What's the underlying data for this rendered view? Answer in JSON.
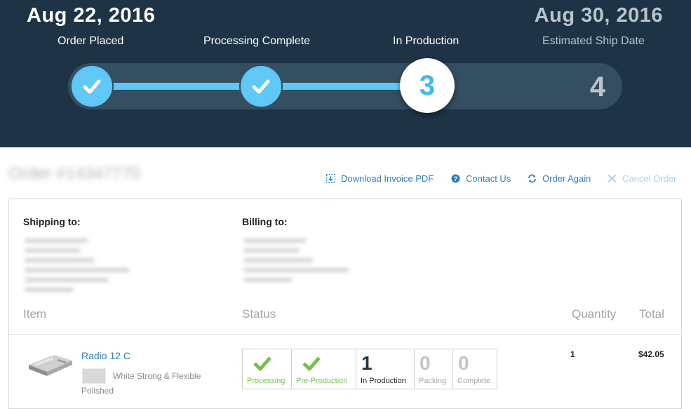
{
  "tracker": {
    "start_date": "Aug 22, 2016",
    "end_date": "Aug 30, 2016",
    "steps": [
      {
        "label": "Order Placed",
        "state": "done"
      },
      {
        "label": "Processing Complete",
        "state": "done"
      },
      {
        "label": "In Production",
        "number": "3",
        "state": "current"
      },
      {
        "label": "Estimated Ship Date",
        "number": "4",
        "state": "future"
      }
    ]
  },
  "order": {
    "title": "Order #14347770"
  },
  "actions": {
    "download_invoice": "Download Invoice PDF",
    "contact_us": "Contact Us",
    "order_again": "Order Again",
    "cancel_order": "Cancel Order"
  },
  "addresses": {
    "shipping_label": "Shipping to:",
    "billing_label": "Billing to:"
  },
  "table": {
    "headers": {
      "item": "Item",
      "status": "Status",
      "quantity": "Quantity",
      "total": "Total"
    },
    "rows": [
      {
        "name": "Radio 12 C",
        "material": "White Strong & Flexible",
        "finish": "Polished",
        "status": [
          {
            "caption": "Processing",
            "state": "done"
          },
          {
            "caption": "Pre-Production",
            "state": "done"
          },
          {
            "caption": "In Production",
            "count": "1",
            "state": "active"
          },
          {
            "caption": "Packing",
            "count": "0",
            "state": "inactive"
          },
          {
            "caption": "Complete",
            "count": "0",
            "state": "inactive"
          }
        ],
        "quantity": "1",
        "total": "$42.05"
      }
    ]
  },
  "colors": {
    "header_bg": "#1e3446",
    "track_bg": "#344e62",
    "progress": "#5fc8f6",
    "link": "#2b7fc1",
    "success": "#74c24b"
  }
}
